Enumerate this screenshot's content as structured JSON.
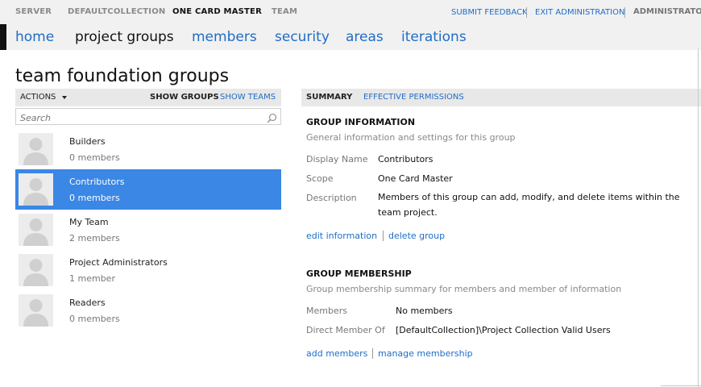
{
  "topbar": {
    "crumbs": [
      "SERVER",
      "DEFAULTCOLLECTION",
      "ONE CARD MASTER",
      "TEAM"
    ],
    "submit_feedback": "SUBMIT FEEDBACK",
    "exit_admin": "EXIT ADMINISTRATION",
    "user": "ADMINISTRATOR"
  },
  "nav": {
    "items": [
      "home",
      "project groups",
      "members",
      "security",
      "areas",
      "iterations"
    ]
  },
  "page": {
    "title": "team foundation groups"
  },
  "left": {
    "actions_label": "ACTIONS",
    "show_groups": "SHOW GROUPS",
    "show_teams": "SHOW TEAMS",
    "search_placeholder": "Search",
    "groups": [
      {
        "name": "Builders",
        "count": "0 members"
      },
      {
        "name": "Contributors",
        "count": "0 members"
      },
      {
        "name": "My Team",
        "count": "2 members"
      },
      {
        "name": "Project Administrators",
        "count": "1 member"
      },
      {
        "name": "Readers",
        "count": "0 members"
      }
    ],
    "selected_index": 1
  },
  "right": {
    "tab_summary": "SUMMARY",
    "tab_permissions": "EFFECTIVE PERMISSIONS",
    "info": {
      "title": "GROUP INFORMATION",
      "subtitle": "General information and settings for this group",
      "display_name_label": "Display Name",
      "display_name_value": "Contributors",
      "scope_label": "Scope",
      "scope_value": "One Card Master",
      "description_label": "Description",
      "description_value": "Members of this group can add, modify, and delete items within the team project.",
      "edit_link": "edit information",
      "delete_link": "delete group"
    },
    "membership": {
      "title": "GROUP MEMBERSHIP",
      "subtitle": "Group membership summary for members and member of information",
      "members_label": "Members",
      "members_value": "No members",
      "direct_label": "Direct Member Of",
      "direct_value": "[DefaultCollection]\\Project Collection Valid Users",
      "add_link": "add members",
      "manage_link": "manage membership"
    }
  },
  "colors": {
    "accent": "#1f6dc6",
    "selected": "#3a87e6",
    "bar_bg": "#f1f1f1"
  }
}
